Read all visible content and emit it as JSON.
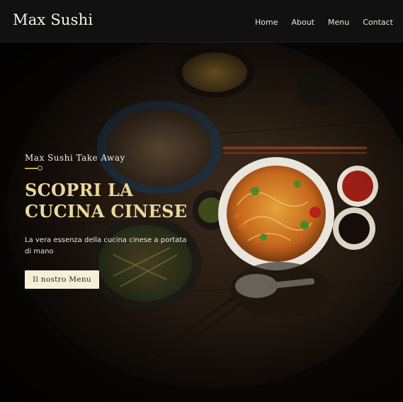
{
  "header": {
    "logo": "Max Sushi",
    "nav": [
      {
        "label": "Home"
      },
      {
        "label": "About"
      },
      {
        "label": "Menu"
      },
      {
        "label": "Contact"
      }
    ]
  },
  "hero": {
    "eyebrow": "Max Sushi Take Away",
    "headline_line1": "SCOPRI LA",
    "headline_line2": "CUCINA CINESE",
    "description": "La vera essenza della cucina cinese a portata di mano",
    "cta_label": "Il nostro Menu"
  },
  "colors": {
    "header_bg": "#111111",
    "accent_gold": "#e9d79c",
    "cta_bg": "#f6efd7",
    "text_light": "#ece8e0"
  },
  "icons": [
    "divider-ornament-icon"
  ]
}
